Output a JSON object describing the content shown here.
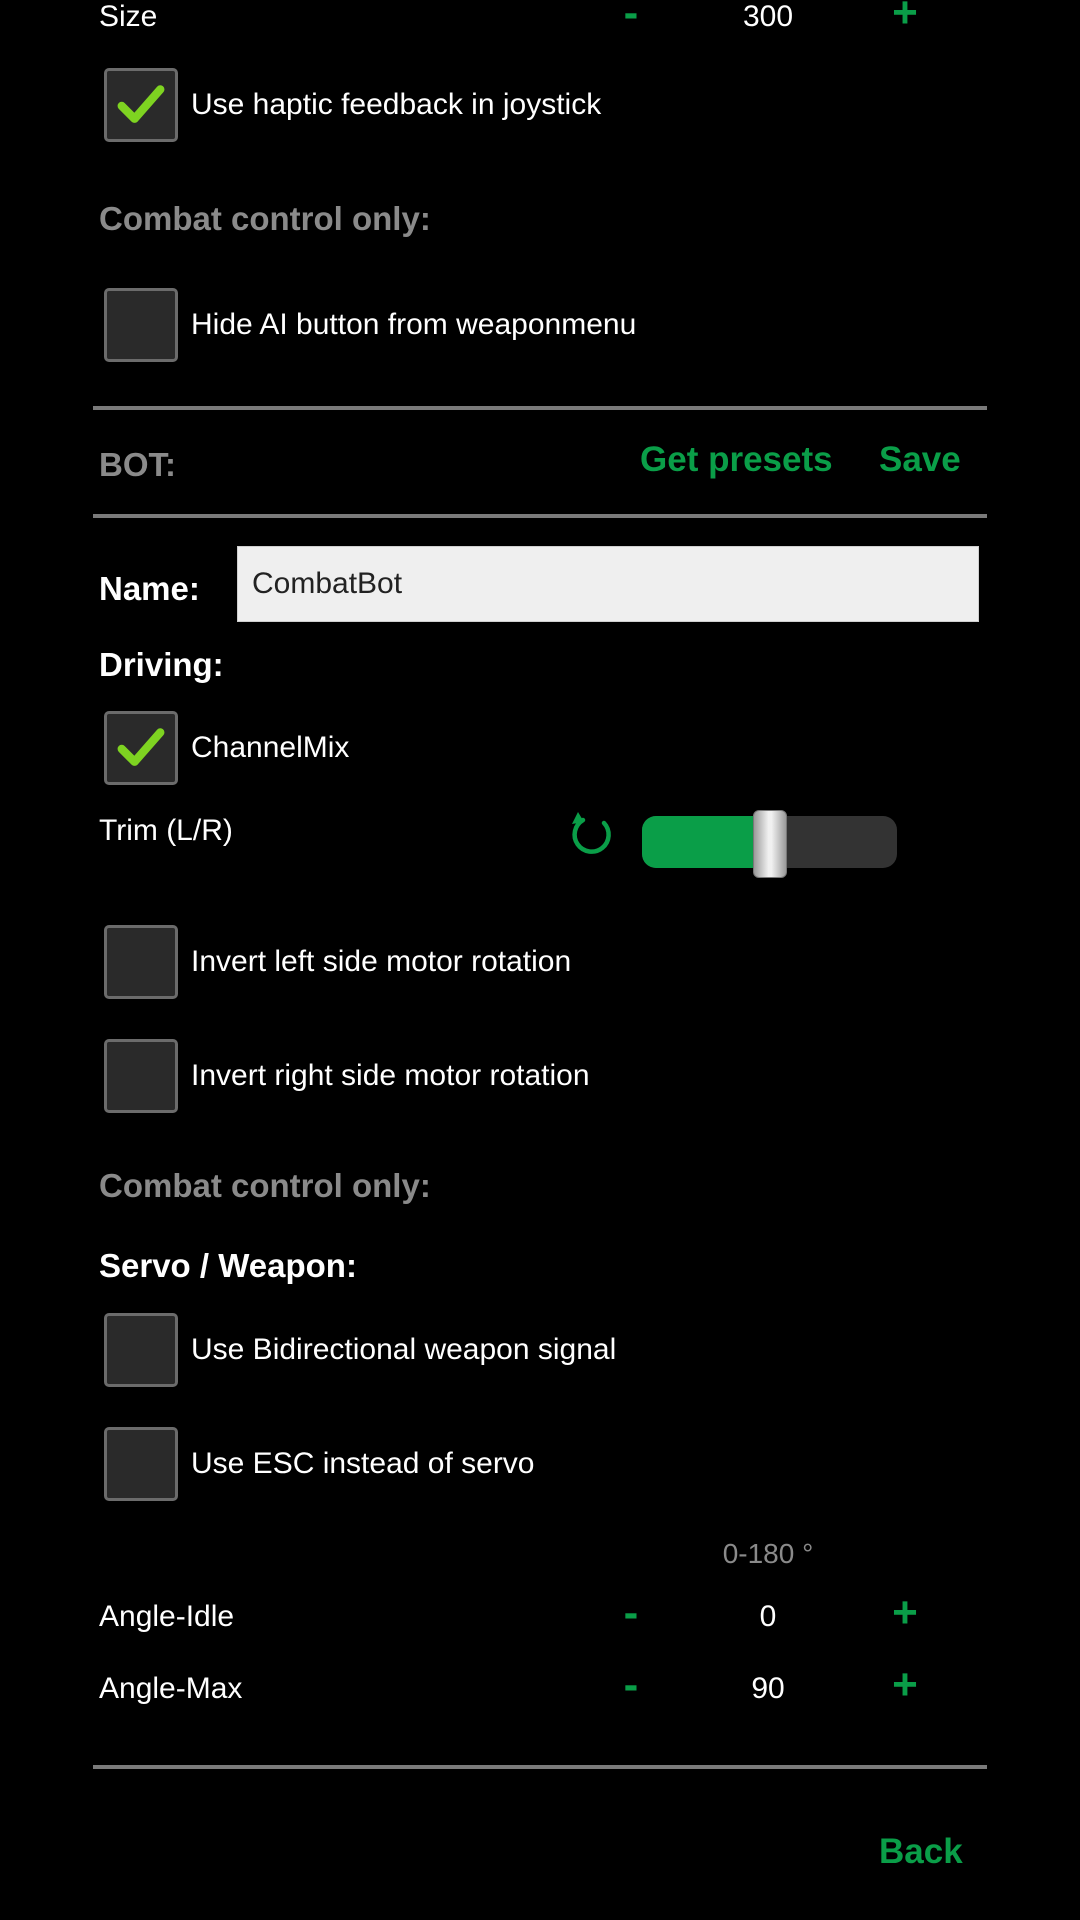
{
  "size_row": {
    "label": "Size",
    "minus": "-",
    "value": "300",
    "plus": "+"
  },
  "haptic": {
    "label": "Use haptic feedback in joystick",
    "checked": true
  },
  "combat_heading_1": "Combat control only:",
  "hide_ai": {
    "label": "Hide AI button from weaponmenu",
    "checked": false
  },
  "bot": {
    "title": "BOT:",
    "get_presets": "Get presets",
    "save": "Save"
  },
  "name": {
    "label": "Name:",
    "value": "CombatBot"
  },
  "driving": {
    "heading": "Driving:",
    "channel_mix": {
      "label": "ChannelMix",
      "checked": true
    },
    "trim": {
      "label": "Trim (L/R)",
      "reset_icon": "reset-icon",
      "level": 0.5
    },
    "invert_left": {
      "label": "Invert left side motor rotation",
      "checked": false
    },
    "invert_right": {
      "label": "Invert right side motor rotation",
      "checked": false
    }
  },
  "combat_heading_2": "Combat control only:",
  "servo": {
    "heading": "Servo / Weapon:",
    "bidirectional": {
      "label": "Use Bidirectional weapon signal",
      "checked": false
    },
    "esc": {
      "label": "Use ESC instead of servo",
      "checked": false
    },
    "range_hint": "0-180 °",
    "angle_idle": {
      "label": "Angle-Idle",
      "minus": "-",
      "value": "0",
      "plus": "+"
    },
    "angle_max": {
      "label": "Angle-Max",
      "minus": "-",
      "value": "90",
      "plus": "+"
    }
  },
  "back": "Back",
  "colors": {
    "accent": "#0a9e48",
    "checkmark": "#7ed321",
    "divider": "#7a7a7a",
    "muted": "#8a8a8a"
  }
}
